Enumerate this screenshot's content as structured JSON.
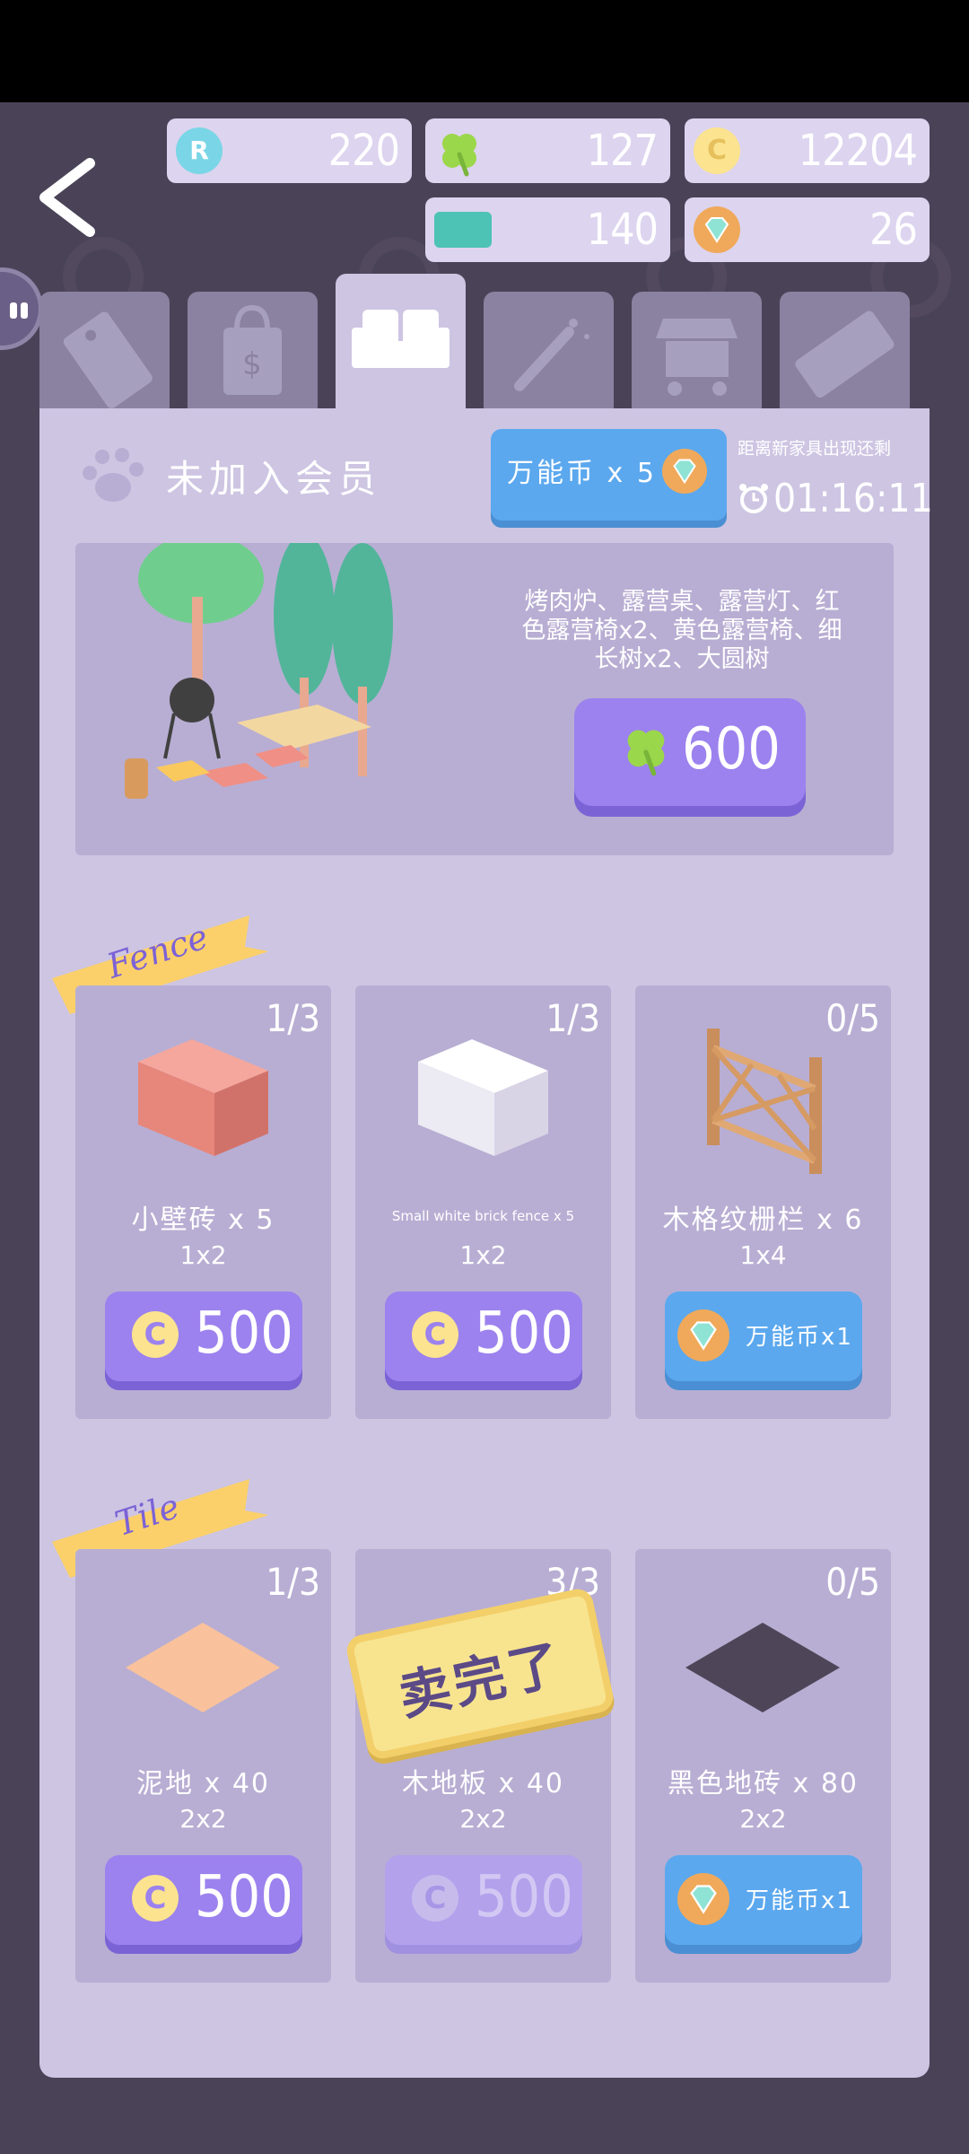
{
  "resources": {
    "r_points": "220",
    "clover": "127",
    "coins": "12204",
    "voucher": "140",
    "gems": "26"
  },
  "tabs": [
    "today",
    "shop",
    "furniture",
    "magic",
    "market",
    "coupon"
  ],
  "active_tab": "furniture",
  "header": {
    "member_status": "未加入会员",
    "wildcard_button": "万能币 x 5",
    "timer_label": "距离新家具出现还剩",
    "timer": "01:16:11"
  },
  "featured": {
    "description": "烤肉炉、露营桌、露营灯、红色露营椅x2、黄色露营椅、细长树x2、大圆树",
    "price": "600"
  },
  "sections": {
    "fence": {
      "title": "Fence",
      "items": [
        {
          "count": "1/3",
          "name": "小壁砖 x 5",
          "size": "1x2",
          "price": "500",
          "pay": "coin"
        },
        {
          "count": "1/3",
          "name": "Small white brick fence x 5",
          "size": "1x2",
          "price": "500",
          "pay": "coin"
        },
        {
          "count": "0/5",
          "name": "木格纹栅栏 x 6",
          "size": "1x4",
          "price": "万能币x1",
          "pay": "gem"
        }
      ]
    },
    "tile": {
      "title": "Tile",
      "items": [
        {
          "count": "1/3",
          "name": "泥地 x 40",
          "size": "2x2",
          "price": "500",
          "pay": "coin"
        },
        {
          "count": "3/3",
          "name": "木地板 x 40",
          "size": "2x2",
          "price": "500",
          "pay": "coin",
          "sold_out": "卖完了"
        },
        {
          "count": "0/5",
          "name": "黑色地砖 x 80",
          "size": "2x2",
          "price": "万能币x1",
          "pay": "gem"
        }
      ]
    }
  },
  "colors": {
    "panel": "#cdc5e2",
    "card": "#b8aed3",
    "purple_button": "#9c82ee",
    "blue_button": "#5ba8ee",
    "ribbon": "#fbd06b"
  }
}
